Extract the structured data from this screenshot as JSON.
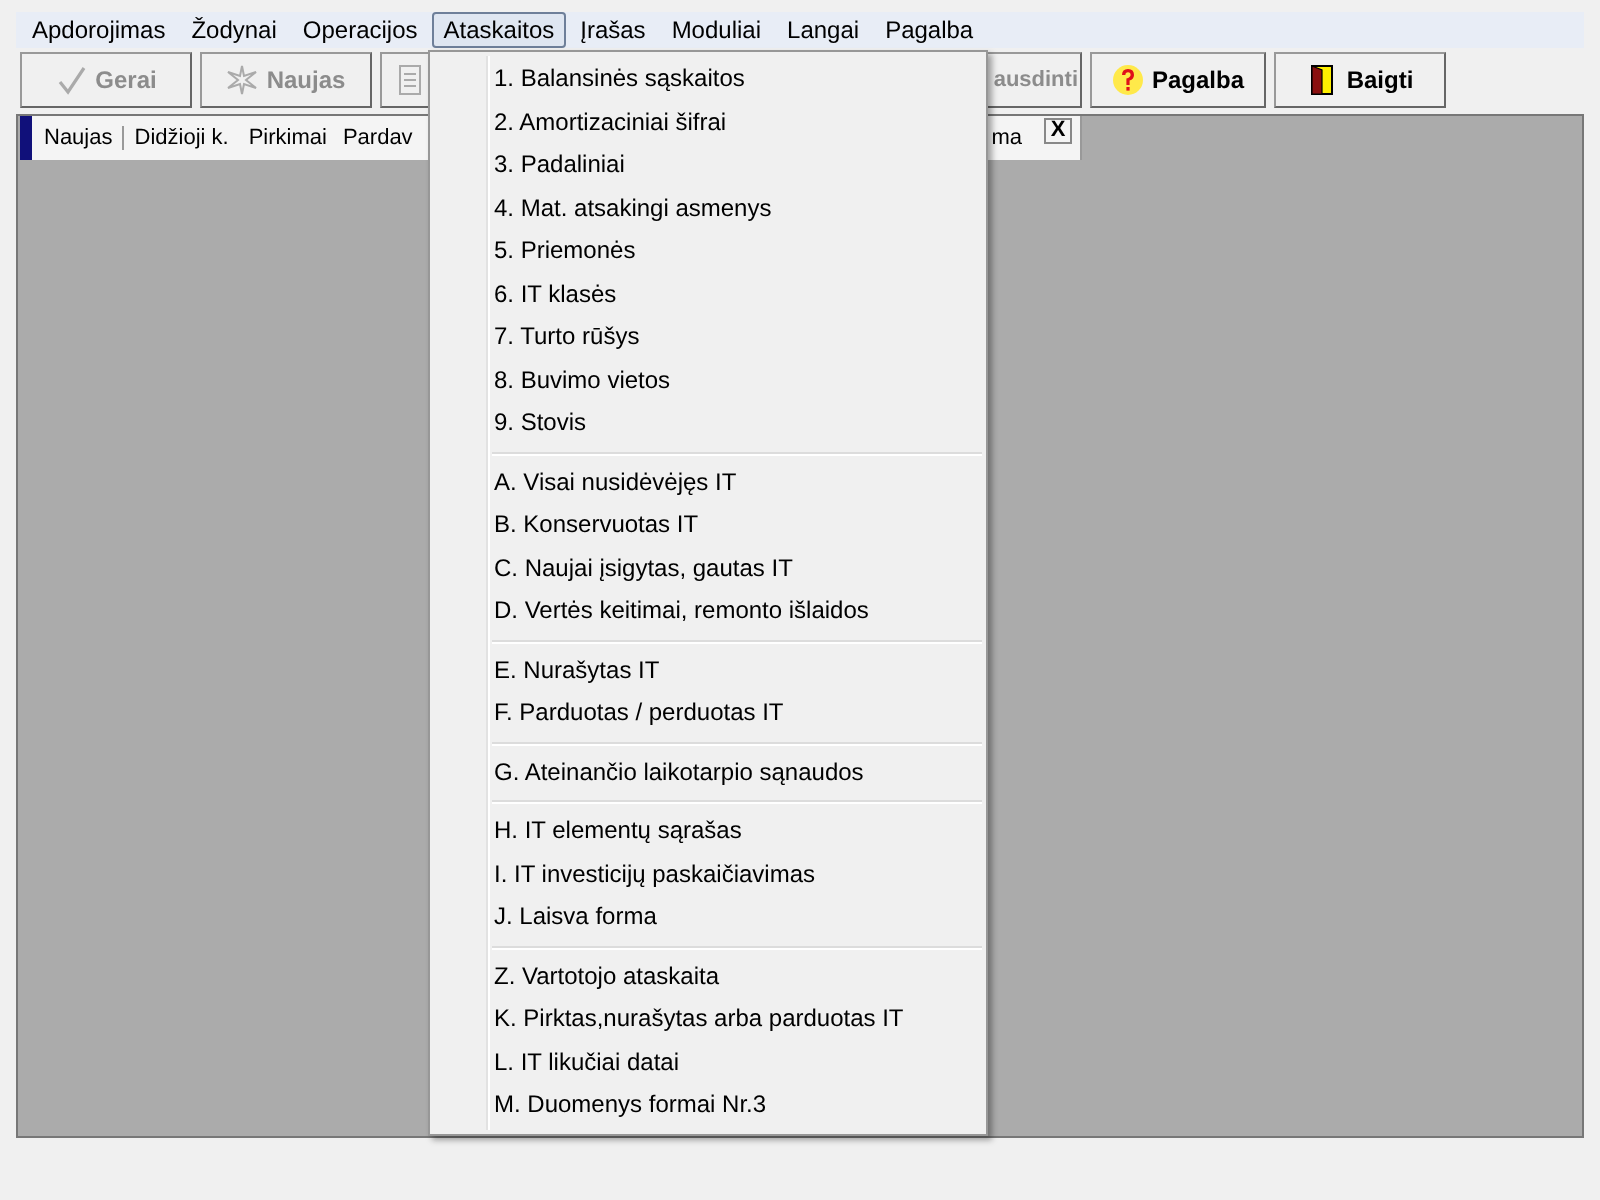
{
  "menubar": [
    {
      "label": "Apdorojimas",
      "selected": false
    },
    {
      "label": "Žodynai",
      "selected": false
    },
    {
      "label": "Operacijos",
      "selected": false
    },
    {
      "label": "Ataskaitos",
      "selected": true
    },
    {
      "label": "Įrašas",
      "selected": false
    },
    {
      "label": "Moduliai",
      "selected": false
    },
    {
      "label": "Langai",
      "selected": false
    },
    {
      "label": "Pagalba",
      "selected": false
    }
  ],
  "toolbar": [
    {
      "kind": "check",
      "label": "Gerai",
      "disabled": true
    },
    {
      "kind": "new",
      "label": "Naujas",
      "disabled": true
    },
    {
      "kind": "doc",
      "disabled": true
    },
    {
      "kind": "text",
      "label": "ausdinti",
      "disabled": true
    },
    {
      "kind": "help",
      "label": "Pagalba",
      "disabled": false
    },
    {
      "kind": "exit",
      "label": "Baigti",
      "disabled": false
    }
  ],
  "tabs": [
    {
      "label": "Naujas",
      "selected": true
    },
    {
      "label": "Didžioji k.",
      "selected": false
    },
    {
      "label": "Pirkimai",
      "selected": false
    },
    {
      "label": "Pardav",
      "selected": false
    },
    {
      "label": "ma",
      "selected": false
    }
  ],
  "close_label": "X",
  "menu": [
    [
      "1. Balansinės sąskaitos",
      "2. Amortizaciniai šifrai",
      "3. Padaliniai",
      "4. Mat. atsakingi asmenys",
      "5. Priemonės",
      "6. IT klasės",
      "7. Turto rūšys",
      "8. Buvimo vietos",
      "9. Stovis"
    ],
    [
      "A. Visai nusidėvėjęs IT",
      "B. Konservuotas IT",
      "C. Naujai įsigytas, gautas IT",
      "D. Vertės keitimai, remonto išlaidos"
    ],
    [
      "E. Nurašytas IT",
      "F. Parduotas / perduotas IT"
    ],
    [
      "G. Ateinančio laikotarpio sąnaudos"
    ],
    [
      "H. IT elementų sąrašas",
      "I. IT investicijų paskaičiavimas",
      "J. Laisva forma"
    ],
    [
      "Z. Vartotojo ataskaita",
      "K. Pirktas,nurašytas arba parduotas IT",
      "L. IT likučiai datai",
      "M. Duomenys formai Nr.3"
    ]
  ]
}
